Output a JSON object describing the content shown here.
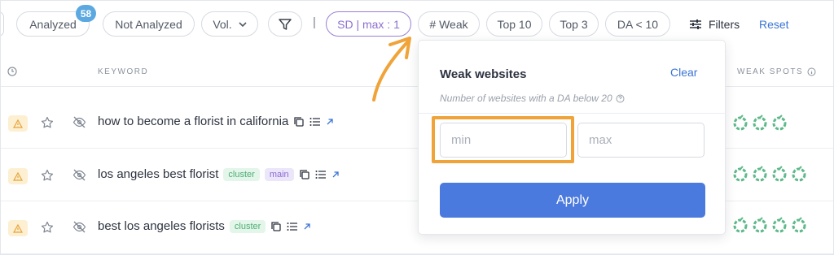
{
  "toolbar": {
    "analyzed_label": "Analyzed",
    "analyzed_count": "58",
    "not_analyzed_label": "Not Analyzed",
    "vol_label": "Vol.",
    "separator": "|",
    "sd_filter_label": "SD | max : 1",
    "weak_filter_label": "# Weak",
    "top10_label": "Top 10",
    "top3_label": "Top 3",
    "da_filter_label": "DA < 10",
    "filters_label": "Filters",
    "reset_label": "Reset"
  },
  "table": {
    "keyword_header": "KEYWORD",
    "weak_spots_header": "WEAK SPOTS",
    "rows": [
      {
        "keyword": "how to become a florist in california",
        "tags": [],
        "weak_spots": 3
      },
      {
        "keyword": "los angeles best florist",
        "tags": [
          "cluster",
          "main"
        ],
        "weak_spots": 4
      },
      {
        "keyword": "best los angeles florists",
        "tags": [
          "cluster"
        ],
        "weak_spots": 4
      }
    ]
  },
  "popup": {
    "title": "Weak websites",
    "clear_label": "Clear",
    "subtitle": "Number of websites with a DA below 20",
    "min_placeholder": "min",
    "max_placeholder": "max",
    "apply_label": "Apply"
  },
  "colors": {
    "accent_blue": "#4b7ade",
    "sd_purple": "#8d6fd0",
    "weak_green": "#5fb98a",
    "highlight_orange": "#f0a338",
    "badge_blue": "#5ba9e0"
  }
}
